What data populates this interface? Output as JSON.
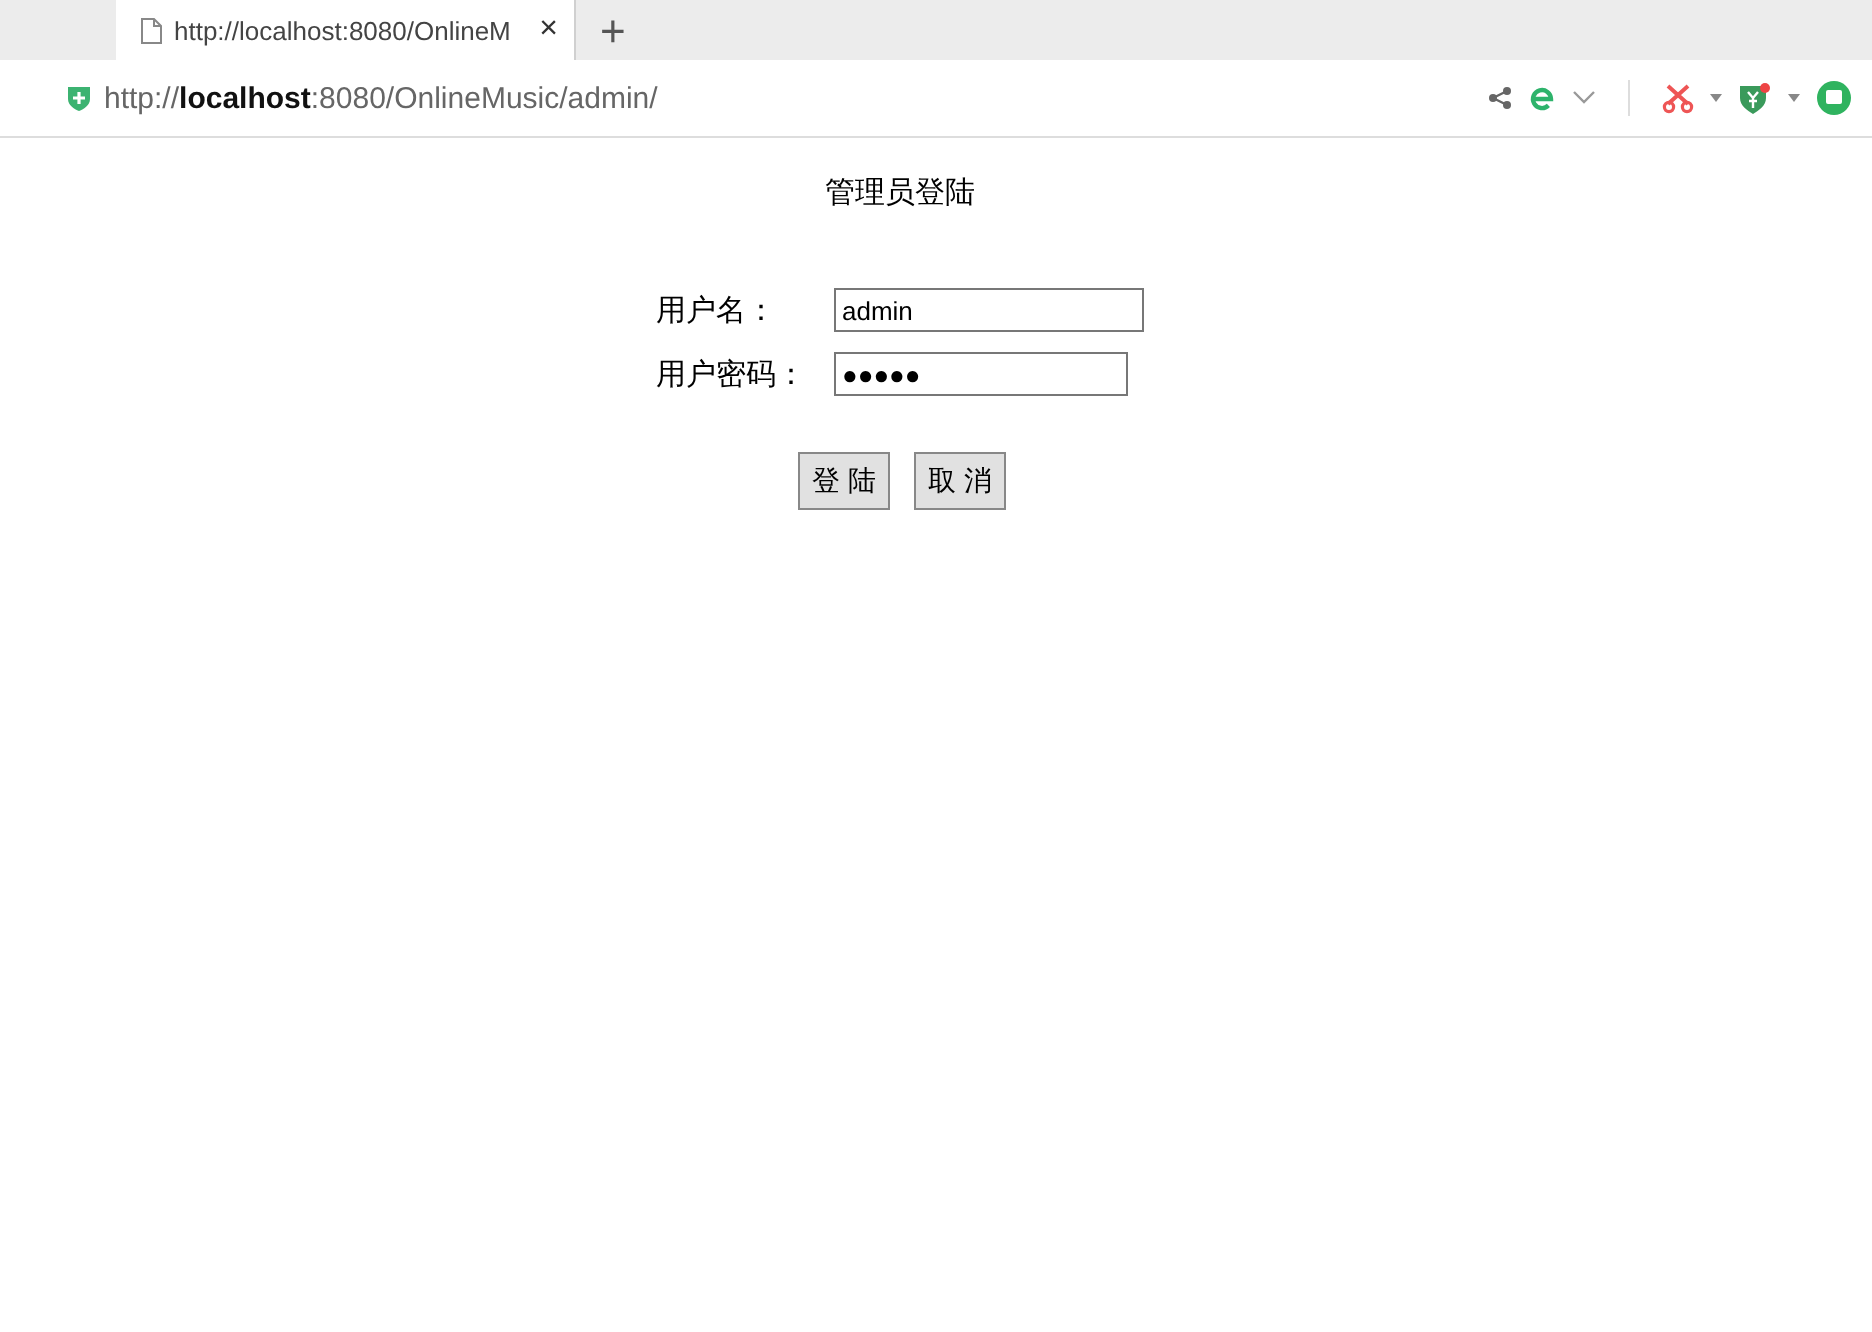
{
  "browser": {
    "tab": {
      "title": "http://localhost:8080/OnlineM",
      "close": "×",
      "selected": true
    },
    "new_tab": "+",
    "address": "http://**localhost**:8080/OnlineMusic/admin/"
  },
  "page": {
    "title": "管理员登陆",
    "fields": [
      {
        "label": "用户名：",
        "value": "admin"
      },
      {
        "label": "用户密码：",
        "value": "●●●●●"
      }
    ],
    "buttons": [
      "登 陆",
      "取 消"
    ]
  }
}
